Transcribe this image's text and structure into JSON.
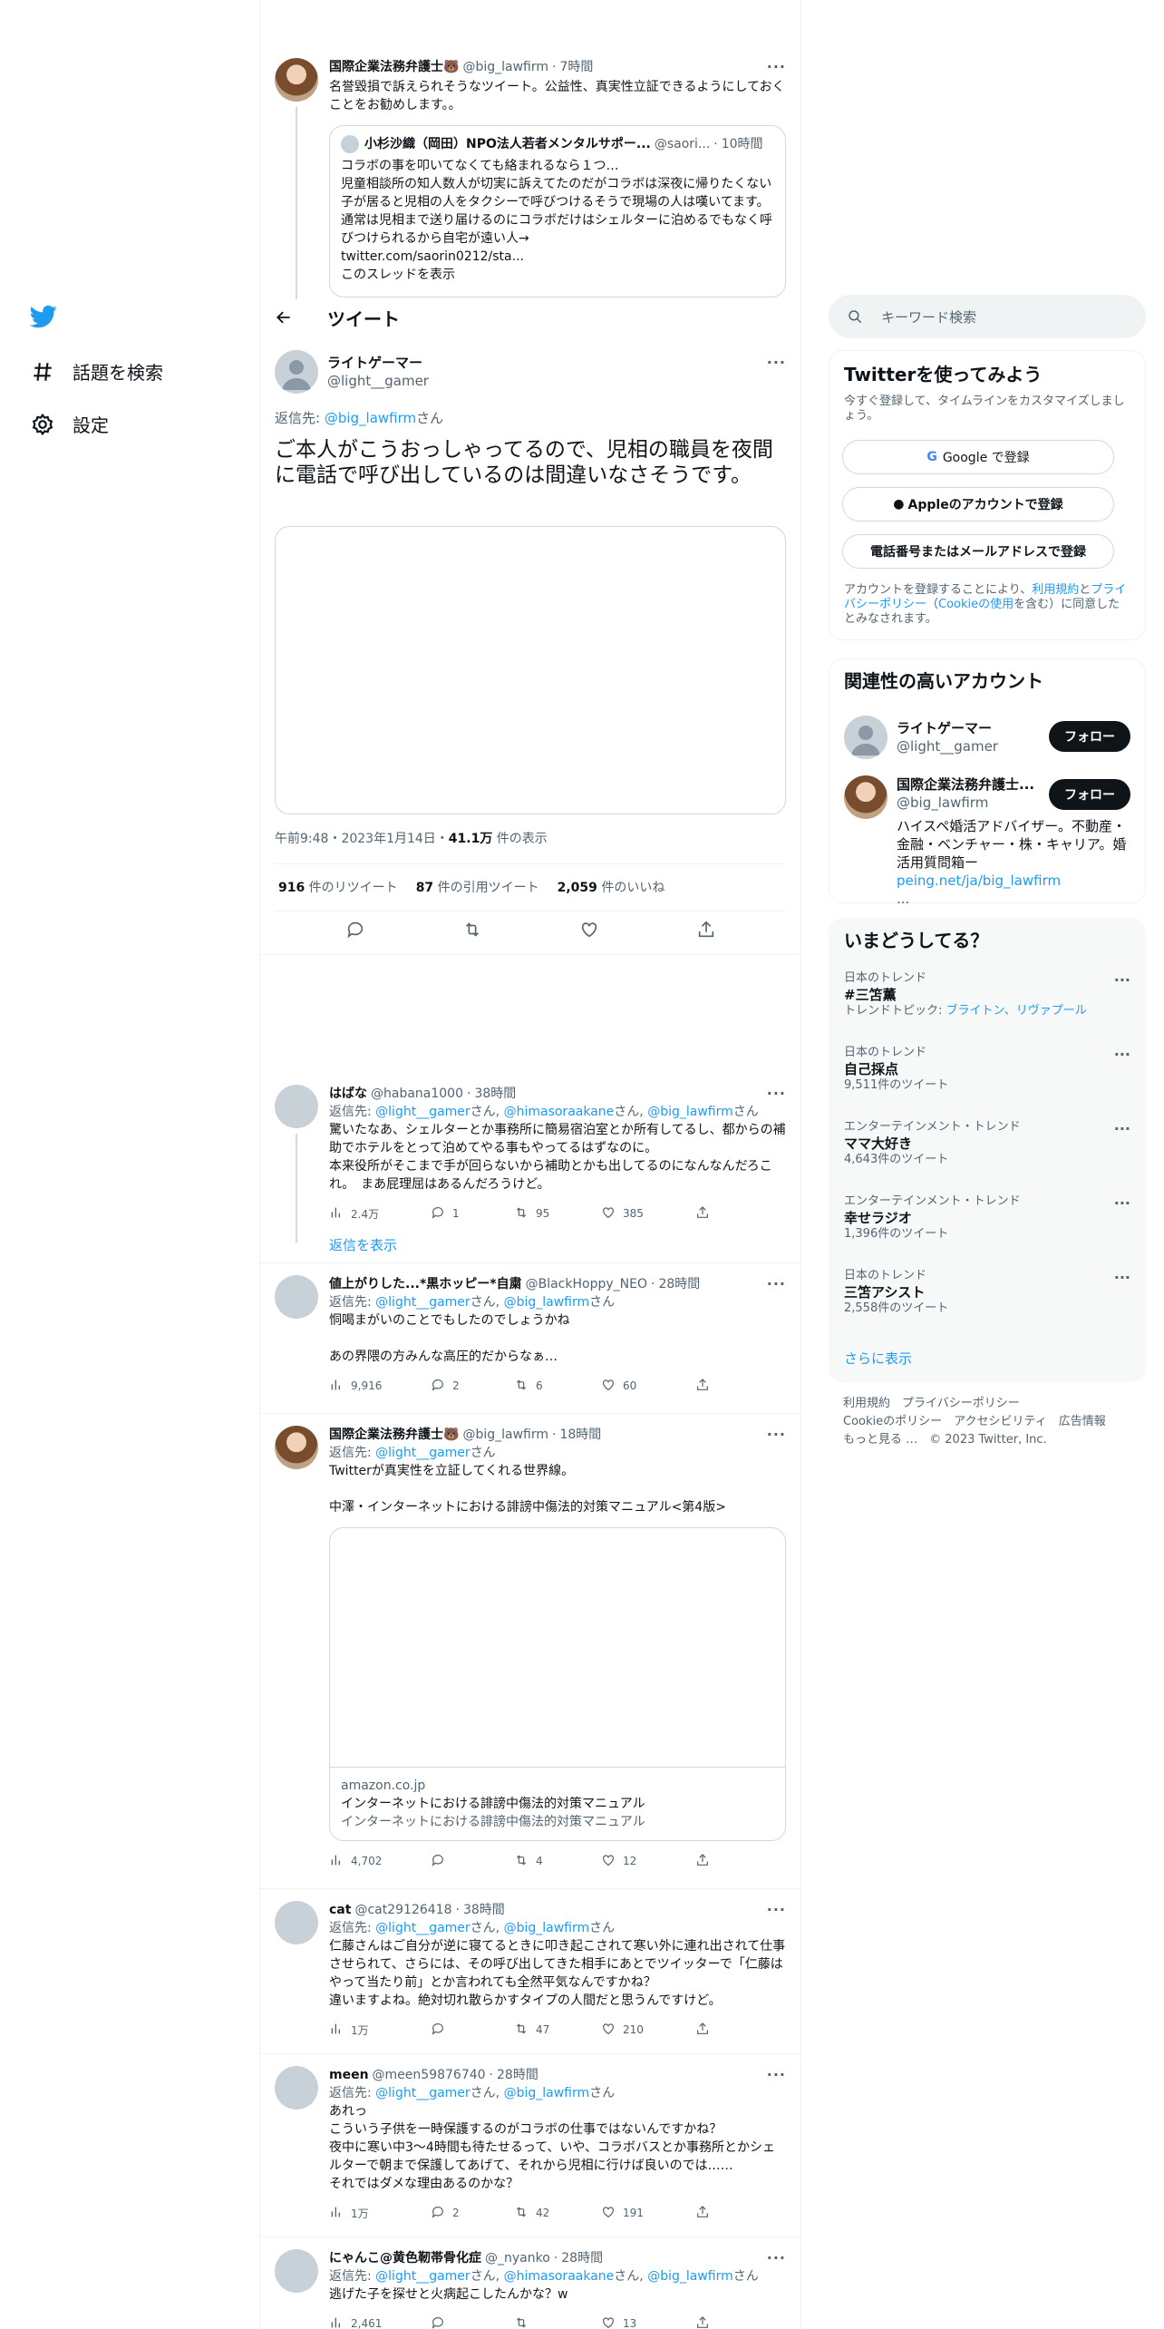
{
  "nav": {
    "explore_label": "話題を検索",
    "settings_label": "設定"
  },
  "quoted_tweet": {
    "name": "国際企業法務弁護士🐻",
    "handle": "@big_lawfirm",
    "time": "7時間",
    "text": "名誉毀損で訴えられそうなツイート。公益性、真実性立証できるようにしておくことをお勧めします。。",
    "quote": {
      "name": "小杉沙織（岡田）NPO法人若者メンタルサポー...",
      "handle": "@saori...",
      "time": "10時間",
      "text": "コラボの事を叩いてなくても絡まれるなら１つ…\n児童相談所の知人数人が切実に訴えてたのだがコラボは深夜に帰りたくない子が居ると児相の人をタクシーで呼びつけるそうで現場の人は嘆いてます。通常は児相まで送り届けるのにコラボだけはシェルターに泊めるでもなく呼びつけられるから自宅が遠い人→",
      "link": "twitter.com/saorin0212/sta...",
      "show_thread": "このスレッドを表示"
    }
  },
  "header": {
    "title": "ツイート"
  },
  "main_tweet": {
    "name": "ライトゲーマー",
    "handle": "@light__gamer",
    "reply_prefix": "返信先: ",
    "reply_to": "@big_lawfirm",
    "reply_suffix": "さん",
    "text": "ご本人がこうおっしゃってるので、児相の職員を夜間に電話で呼び出しているのは間違いなさそうです。",
    "timestamp": "午前9:48・2023年1月14日・",
    "views": "41.1万",
    "views_label": " 件の表示",
    "retweets": "916",
    "retweets_label": " 件のリツイート",
    "quotes": "87",
    "quotes_label": " 件の引用ツイート",
    "likes": "2,059",
    "likes_label": " 件のいいね"
  },
  "replies": [
    {
      "name": "はばな",
      "handle": "@habana1000",
      "time": "38時間",
      "reply_html": "返信先: @light__gamerさん, @himasoraakaneさん, @big_lawfirmさん",
      "reply_parts": [
        "@light__gamer",
        "さん, ",
        "@himasoraakane",
        "さん, ",
        "@big_lawfirm",
        "さん"
      ],
      "text": "驚いたなあ、シェルターとか事務所に簡易宿泊室とか所有してるし、都からの補助でホテルをとって泊めてやる事もやってるはずなのに。\n本来役所がそこまで手が回らないから補助とかも出してるのになんなんだろこれ。　まあ屁理屈はあるんだろうけど。",
      "views": "2.4万",
      "replies": "1",
      "retweets": "95",
      "likes": "385",
      "show_replies": "返信を表示"
    },
    {
      "name": "値上がりした...*黒ホッピー*自粛",
      "handle": "@BlackHoppy_NEO",
      "time": "28時間",
      "reply_parts": [
        "@light__gamer",
        "さん, ",
        "@big_lawfirm",
        "さん"
      ],
      "text": "恫喝まがいのことでもしたのでしょうかね\n\nあの界隈の方みんな高圧的だからなぁ…",
      "views": "9,916",
      "replies": "2",
      "retweets": "6",
      "likes": "60"
    },
    {
      "name": "国際企業法務弁護士🐻",
      "handle": "@big_lawfirm",
      "time": "18時間",
      "reply_parts": [
        "@light__gamer",
        "さん"
      ],
      "text": "Twitterが真実性を立証してくれる世界線。\n\n中澤・インターネットにおける誹謗中傷法的対策マニュアル<第4版>",
      "card": {
        "domain": "amazon.co.jp",
        "title": "インターネットにおける誹謗中傷法的対策マニュアル",
        "desc": "インターネットにおける誹謗中傷法的対策マニュアル"
      },
      "views": "4,702",
      "replies": "",
      "retweets": "4",
      "likes": "12"
    },
    {
      "name": "cat",
      "handle": "@cat29126418",
      "time": "38時間",
      "reply_parts": [
        "@light__gamer",
        "さん, ",
        "@big_lawfirm",
        "さん"
      ],
      "text": "仁藤さんはご自分が逆に寝てるときに叩き起こされて寒い外に連れ出されて仕事させられて、さらには、その呼び出してきた相手にあとでツイッターで「仁藤はやって当たり前」とか言われても全然平気なんですかね？\n違いますよね。絶対切れ散らかすタイプの人間だと思うんですけど。",
      "views": "1万",
      "replies": "",
      "retweets": "47",
      "likes": "210"
    },
    {
      "name": "meen",
      "handle": "@meen59876740",
      "time": "28時間",
      "reply_parts": [
        "@light__gamer",
        "さん, ",
        "@big_lawfirm",
        "さん"
      ],
      "text": "あれっ\nこういう子供を一時保護するのがコラボの仕事ではないんですかね？\n夜中に寒い中3～4時間も待たせるって、いや、コラボバスとか事務所とかシェルターで朝まで保護してあげて、それから児相に行けば良いのでは……\nそれではダメな理由あるのかな？",
      "views": "1万",
      "replies": "2",
      "retweets": "42",
      "likes": "191"
    },
    {
      "name": "にゃんこ@黄色靭帯骨化症",
      "handle": "@_nyanko",
      "time": "28時間",
      "reply_parts": [
        "@light__gamer",
        "さん, ",
        "@himasoraakane",
        "さん, ",
        "@big_lawfirm",
        "さん"
      ],
      "text": "逃げた子を探せと火病起こしたんかな？w",
      "views": "2,461",
      "replies": "",
      "retweets": "",
      "likes": "13"
    }
  ],
  "reply_prefix": "返信先: ",
  "sidebar": {
    "search_placeholder": "キーワード検索",
    "signup": {
      "title": "Twitterを使ってみよう",
      "subtitle": "今すぐ登録して、タイムラインをカスタマイズしましょう。",
      "google_button": "Google で登録",
      "apple_button": "Appleのアカウントで登録",
      "phone_button": "電話番号またはメールアドレスで登録",
      "terms_1": "アカウントを登録することにより、",
      "terms_link1": "利用規約",
      "terms_2": "と",
      "terms_link2": "プライバシーポリシー",
      "terms_3": "（",
      "terms_link3": "Cookieの使用",
      "terms_4": "を含む）に同意したとみなされます。"
    },
    "relevant": {
      "title": "関連性の高いアカウント",
      "accounts": [
        {
          "name": "ライトゲーマー",
          "handle": "@light__gamer",
          "follow": "フォロー",
          "bio": ""
        },
        {
          "name": "国際企業法務弁護士...",
          "handle": "@big_lawfirm",
          "follow": "フォロー",
          "bio": "ハイスペ婚活アドバイザー。不動産・金融・ベンチャー・株・キャリア。婚活用質問箱ー",
          "bio_link": "peing.net/ja/big_lawfirm",
          "bio_more": "..."
        }
      ]
    },
    "trends": {
      "title": "いまどうしてる？",
      "items": [
        {
          "context": "日本のトレンド",
          "name": "#三笘薫",
          "count_prefix": "トレンドトピック: ",
          "count_link": "ブライトン、リヴァプール",
          "count": ""
        },
        {
          "context": "日本のトレンド",
          "name": "自己採点",
          "count": "9,511件のツイート"
        },
        {
          "context": "エンターテインメント・トレンド",
          "name": "ママ大好き",
          "count": "4,643件のツイート"
        },
        {
          "context": "エンターテインメント・トレンド",
          "name": "幸せラジオ",
          "count": "1,396件のツイート"
        },
        {
          "context": "日本のトレンド",
          "name": "三笘アシスト",
          "count": "2,558件のツイート"
        }
      ],
      "show_more": "さらに表示"
    },
    "footer": {
      "line1": [
        "利用規約",
        "プライバシーポリシー"
      ],
      "line2": [
        "Cookieのポリシー",
        "アクセシビリティ",
        "広告情報"
      ],
      "line3": [
        "もっと見る …",
        "© 2023 Twitter, Inc."
      ]
    }
  }
}
